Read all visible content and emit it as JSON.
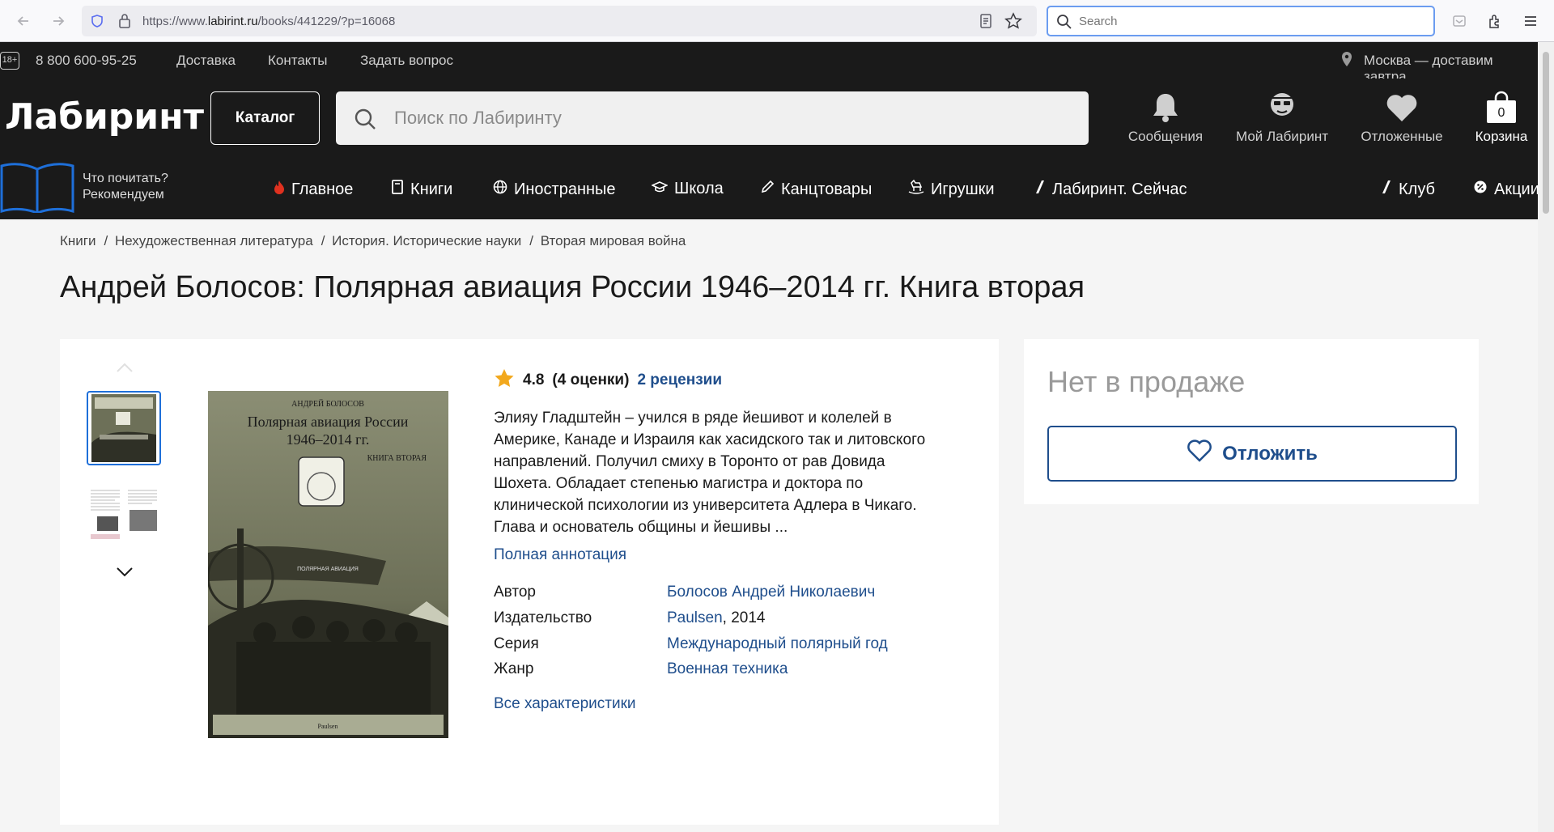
{
  "browser": {
    "url_prefix": "https://www.",
    "url_domain": "labirint.ru",
    "url_path": "/books/441229/?p=16068",
    "search_placeholder": "Search"
  },
  "topstrip": {
    "age": "18+",
    "phone": "8 800 600-95-25",
    "links": [
      "Доставка",
      "Контакты",
      "Задать вопрос"
    ],
    "location": "Москва — доставим завтра"
  },
  "header": {
    "logo": "Лабиринт",
    "catalog_label": "Каталог",
    "search_placeholder": "Поиск по Лабиринту",
    "icons": [
      {
        "label": "Сообщения",
        "icon": "bell-icon"
      },
      {
        "label": "Мой Лабиринт",
        "icon": "profile-icon"
      },
      {
        "label": "Отложенные",
        "icon": "heart-icon"
      },
      {
        "label": "Корзина",
        "icon": "cart-icon",
        "count": "0"
      }
    ]
  },
  "nav": {
    "promo_line1": "Что почитать?",
    "promo_line2": "Рекомендуем",
    "items": [
      {
        "label": "Главное",
        "icon": "flame-icon"
      },
      {
        "label": "Книги",
        "icon": "book-icon"
      },
      {
        "label": "Иностранные",
        "icon": "globe-icon"
      },
      {
        "label": "Школа",
        "icon": "graduation-cap-icon"
      },
      {
        "label": "Канцтовары",
        "icon": "pencil-icon"
      },
      {
        "label": "Игрушки",
        "icon": "rocking-horse-icon"
      },
      {
        "label": "Лабиринт. Сейчас",
        "icon": "labirint-logo-icon"
      },
      {
        "label": "Клуб",
        "icon": "labirint-logo-icon"
      },
      {
        "label": "Акции",
        "icon": "gear-badge-icon"
      }
    ]
  },
  "breadcrumbs": [
    "Книги",
    "Нехудожественная литература",
    "История. Исторические науки",
    "Вторая мировая война"
  ],
  "product": {
    "title": "Андрей Болосов: Полярная авиация России 1946–2014 гг. Книга вторая",
    "rating": "4.8",
    "ratings_count": "(4 оценки)",
    "reviews": "2 рецензии",
    "annotation": "Элияу Гладштейн – учился в ряде йешивот и колелей в Америке, Канаде и Израиля как хасидского так и литовского направлений. Получил смиху в Торонто от рав Довида Шохета. Обладает степенью магистра и доктора по клинической психологии из университета Адлера в Чикаго. Глава и основатель общины и йешивы ...",
    "full_annotation_link": "Полная аннотация",
    "attributes": [
      {
        "name": "Автор",
        "value": "Болосов Андрей Николаевич",
        "suffix": ""
      },
      {
        "name": "Издательство",
        "value": "Paulsen",
        "suffix": ", 2014"
      },
      {
        "name": "Серия",
        "value": "Международный полярный год",
        "suffix": ""
      },
      {
        "name": "Жанр",
        "value": "Военная техника",
        "suffix": ""
      }
    ],
    "all_specs_link": "Все характеристики",
    "cover": {
      "author": "АНДРЕЙ БОЛОСОВ",
      "title_line1": "Полярная авиация России",
      "title_line2": "1946–2014 гг.",
      "subtitle": "КНИГА ВТОРАЯ",
      "plane_label": "ПОЛЯРНАЯ АВИАЦИЯ",
      "publisher": "Paulsen"
    }
  },
  "sidebar": {
    "availability": "Нет в продаже",
    "wishlist_label": "Отложить"
  },
  "colors": {
    "dark": "#1a1a1a",
    "link": "#1f4e8c",
    "accent_blue": "#1e6fd9",
    "star": "#f2a81d",
    "flame": "#e0311f"
  }
}
